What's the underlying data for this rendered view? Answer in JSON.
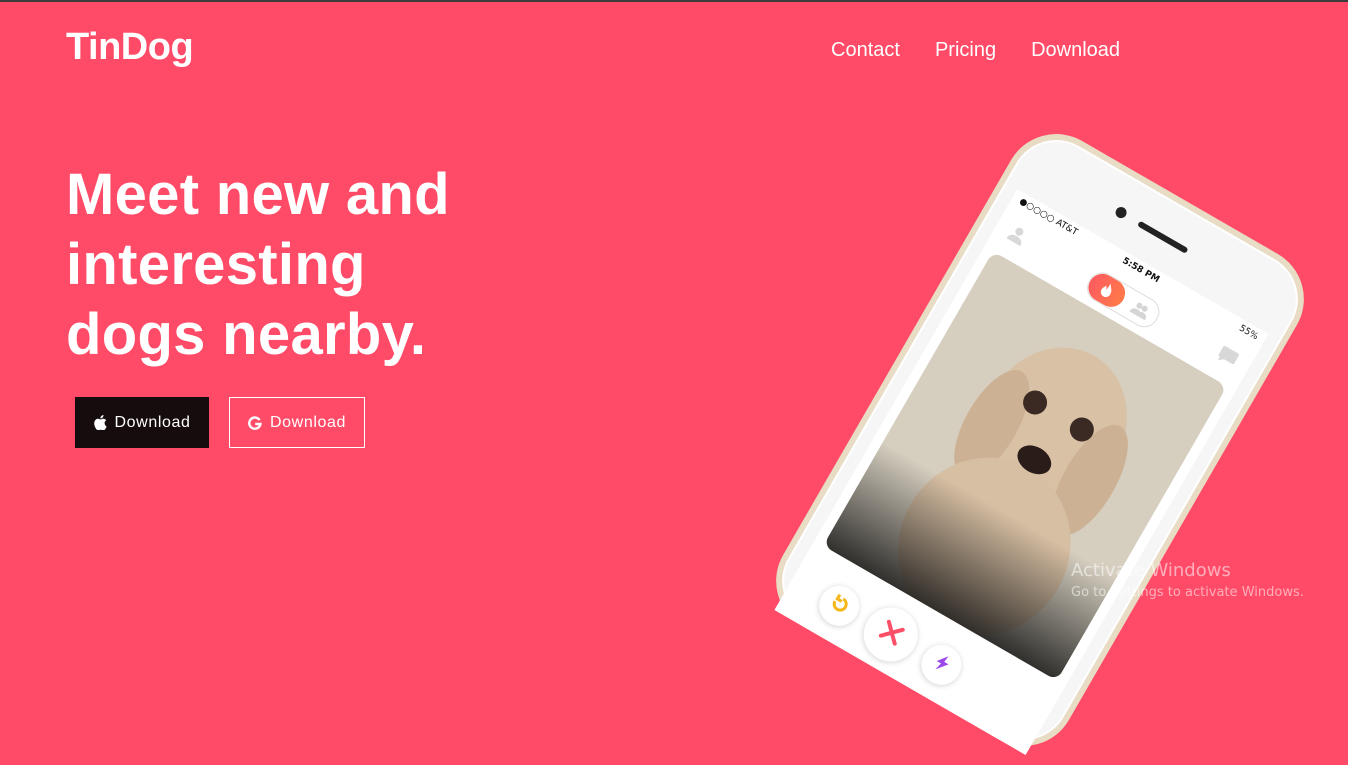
{
  "brand": {
    "name": "TinDog"
  },
  "nav": {
    "items": [
      "Contact",
      "Pricing",
      "Download"
    ]
  },
  "hero": {
    "headline_lines": [
      "Meet new and",
      "interesting",
      "dogs nearby."
    ],
    "buttons": {
      "apple_label": "Download",
      "google_label": "Download"
    }
  },
  "phone": {
    "carrier": "●○○○○ AT&T",
    "time": "5:58 PM",
    "battery": "55%"
  },
  "watermark": {
    "title": "Activate Windows",
    "subtitle": "Go to Settings to activate Windows."
  },
  "colors": {
    "background": "#ff4b67",
    "apple_button": "#160c0d",
    "text": "#ffffff"
  },
  "icons": [
    "apple-icon",
    "google-icon",
    "profile-icon",
    "flame-icon",
    "people-icon",
    "chat-icon",
    "undo-icon",
    "nope-icon",
    "boost-icon"
  ]
}
